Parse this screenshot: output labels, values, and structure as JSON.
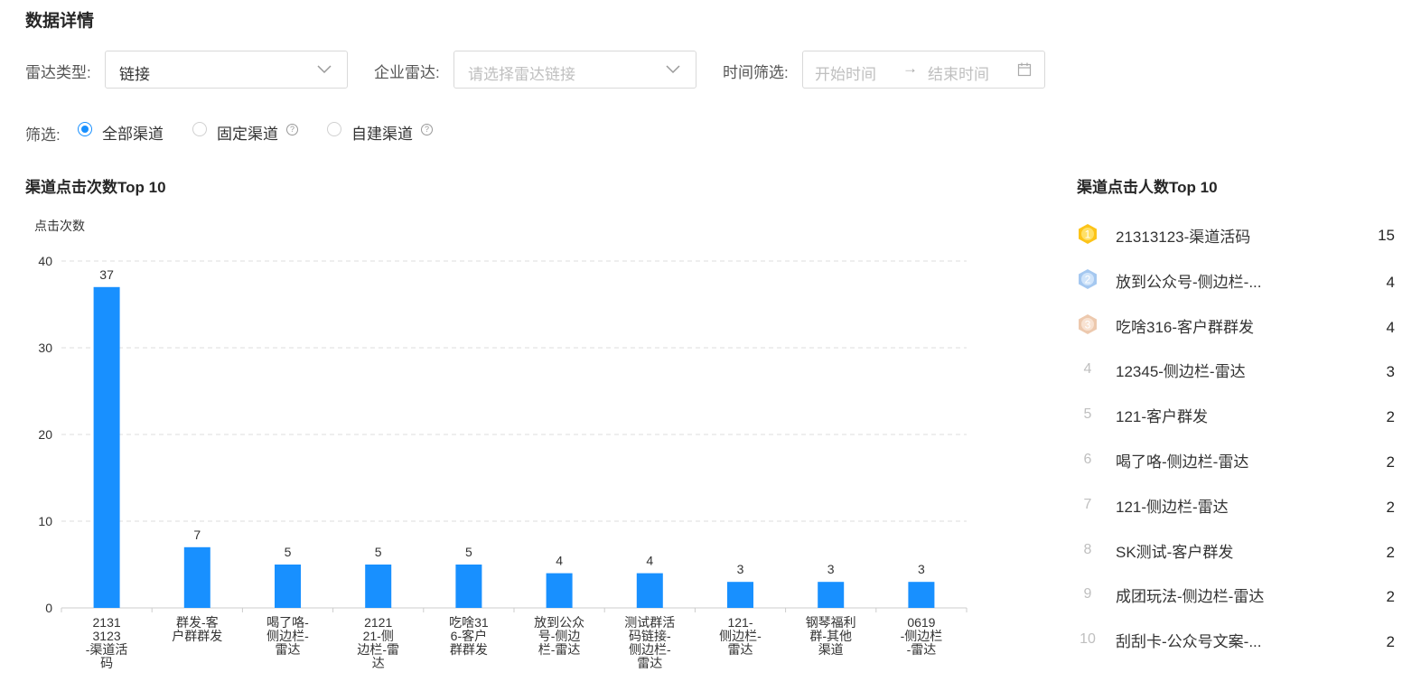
{
  "page_title": "数据详情",
  "filters": {
    "radar_type_label": "雷达类型:",
    "radar_type_value": "链接",
    "enterprise_radar_label": "企业雷达:",
    "enterprise_radar_placeholder": "请选择雷达链接",
    "time_label": "时间筛选:",
    "start_placeholder": "开始时间",
    "arrow": "→",
    "end_placeholder": "结束时间"
  },
  "channel_filter": {
    "label": "筛选:",
    "options": [
      {
        "label": "全部渠道",
        "checked": true,
        "help": false
      },
      {
        "label": "固定渠道",
        "checked": false,
        "help": true
      },
      {
        "label": "自建渠道",
        "checked": false,
        "help": true
      }
    ]
  },
  "left_section_title": "渠道点击次数Top 10",
  "right_section_title": "渠道点击人数Top 10",
  "chart_data": {
    "type": "bar",
    "ylabel": "点击次数",
    "ylim": [
      0,
      40
    ],
    "yticks": [
      0,
      10,
      20,
      30,
      40
    ],
    "grid": true,
    "bar_color": "#1890ff",
    "categories": [
      [
        "2131",
        "3123",
        "-渠道活",
        "码"
      ],
      [
        "群发-客",
        "户群群发"
      ],
      [
        "喝了咯-",
        "侧边栏-",
        "雷达"
      ],
      [
        "2121",
        "21-侧",
        "边栏-雷",
        "达"
      ],
      [
        "吃啥31",
        "6-客户",
        "群群发"
      ],
      [
        "放到公众",
        "号-侧边",
        "栏-雷达"
      ],
      [
        "测试群活",
        "码链接-",
        "侧边栏-",
        "雷达"
      ],
      [
        "121-",
        "侧边栏-",
        "雷达"
      ],
      [
        "钢琴福利",
        "群-其他",
        "渠道"
      ],
      [
        "0619",
        "-侧边栏",
        "-雷达"
      ]
    ],
    "values": [
      37,
      7,
      5,
      5,
      5,
      4,
      4,
      3,
      3,
      3
    ]
  },
  "ranking": [
    {
      "rank": "1",
      "name": "21313123-渠道活码",
      "value": "15",
      "badge": "gold"
    },
    {
      "rank": "2",
      "name": "放到公众号-侧边栏-...",
      "value": "4",
      "badge": "silver"
    },
    {
      "rank": "3",
      "name": "吃啥316-客户群群发",
      "value": "4",
      "badge": "bronze"
    },
    {
      "rank": "4",
      "name": "12345-侧边栏-雷达",
      "value": "3",
      "badge": ""
    },
    {
      "rank": "5",
      "name": "121-客户群发",
      "value": "2",
      "badge": ""
    },
    {
      "rank": "6",
      "name": "喝了咯-侧边栏-雷达",
      "value": "2",
      "badge": ""
    },
    {
      "rank": "7",
      "name": "121-侧边栏-雷达",
      "value": "2",
      "badge": ""
    },
    {
      "rank": "8",
      "name": "SK测试-客户群发",
      "value": "2",
      "badge": ""
    },
    {
      "rank": "9",
      "name": "成团玩法-侧边栏-雷达",
      "value": "2",
      "badge": ""
    },
    {
      "rank": "10",
      "name": "刮刮卡-公众号文案-...",
      "value": "2",
      "badge": ""
    }
  ]
}
